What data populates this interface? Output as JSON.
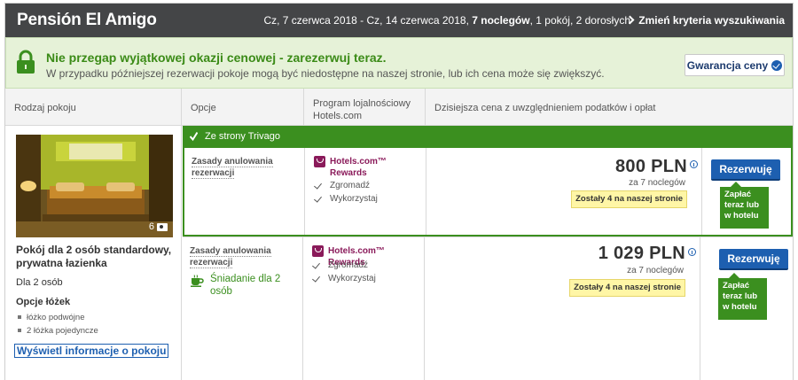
{
  "header": {
    "hotel_name": "Pensión El Amigo",
    "dates_prefix": "Cz, 7 czerwca 2018 - Cz, 14 czerwca 2018, ",
    "nights_bold": "7 noclegów",
    "dates_suffix": ", 1 pokój, 2 dorosłych",
    "change_criteria": "Zmień kryteria wyszukiwania"
  },
  "promo": {
    "title": "Nie przegap wyjątkowej okazji cenowej - zarezerwuj teraz.",
    "subtitle": "W przypadku późniejszej rezerwacji pokoje mogą być niedostępne na naszej stronie, lub ich cena może się zwiększyć.",
    "guarantee_button": "Gwarancja ceny"
  },
  "columns": {
    "room_type": "Rodzaj pokoju",
    "options": "Opcje",
    "loyalty": "Program lojalnościowy Hotels.com",
    "price": "Dzisiejsza cena z uwzględnieniem podatków i opłat"
  },
  "room": {
    "photo_count": "6",
    "name": "Pokój dla 2 osób standardowy, prywatna łazienka",
    "occupancy": "Dla 2 osób",
    "bed_options_title": "Opcje łóżek",
    "bed_options": [
      "łóżko podwójne",
      "2 łóżka pojedyncze"
    ],
    "info_link": "Wyświetl informacje o pokoju"
  },
  "trivago_label": "Ze strony Trivago",
  "offers": [
    {
      "cancel_policy": "Zasady anulowania rezerwacji",
      "loyalty_title": "Hotels.com™ Rewards",
      "loyalty_collect": "Zgromadź",
      "loyalty_redeem": "Wykorzystaj",
      "price": "800 PLN",
      "nights": "za 7 noclegów",
      "scarcity": "Zostały 4 na naszej stronie",
      "book_button": "Rezerwuję",
      "pay_tag": "Zapłać teraz lub w hotelu"
    },
    {
      "cancel_policy": "Zasady anulowania rezerwacji",
      "breakfast": "Śniadanie dla 2 osób",
      "loyalty_title": "Hotels.com™ Rewards",
      "loyalty_collect": "Zgromadź",
      "loyalty_redeem": "Wykorzystaj",
      "price": "1 029 PLN",
      "nights": "za 7 noclegów",
      "scarcity": "Zostały 4 na naszej stronie",
      "book_button": "Rezerwuję",
      "pay_tag": "Zapłać teraz lub w hotelu"
    }
  ],
  "colors": {
    "header_bg": "#444547",
    "brand_green": "#3b8f1f",
    "book_blue": "#1d5fb0",
    "loyalty_purple": "#8a1a5a",
    "scarcity_yellow": "#fff6a6"
  },
  "icons": [
    "lock-icon",
    "check-icon",
    "camera-icon",
    "rewards-icon",
    "coffee-cup-icon",
    "info-icon",
    "chevron-right-icon"
  ]
}
